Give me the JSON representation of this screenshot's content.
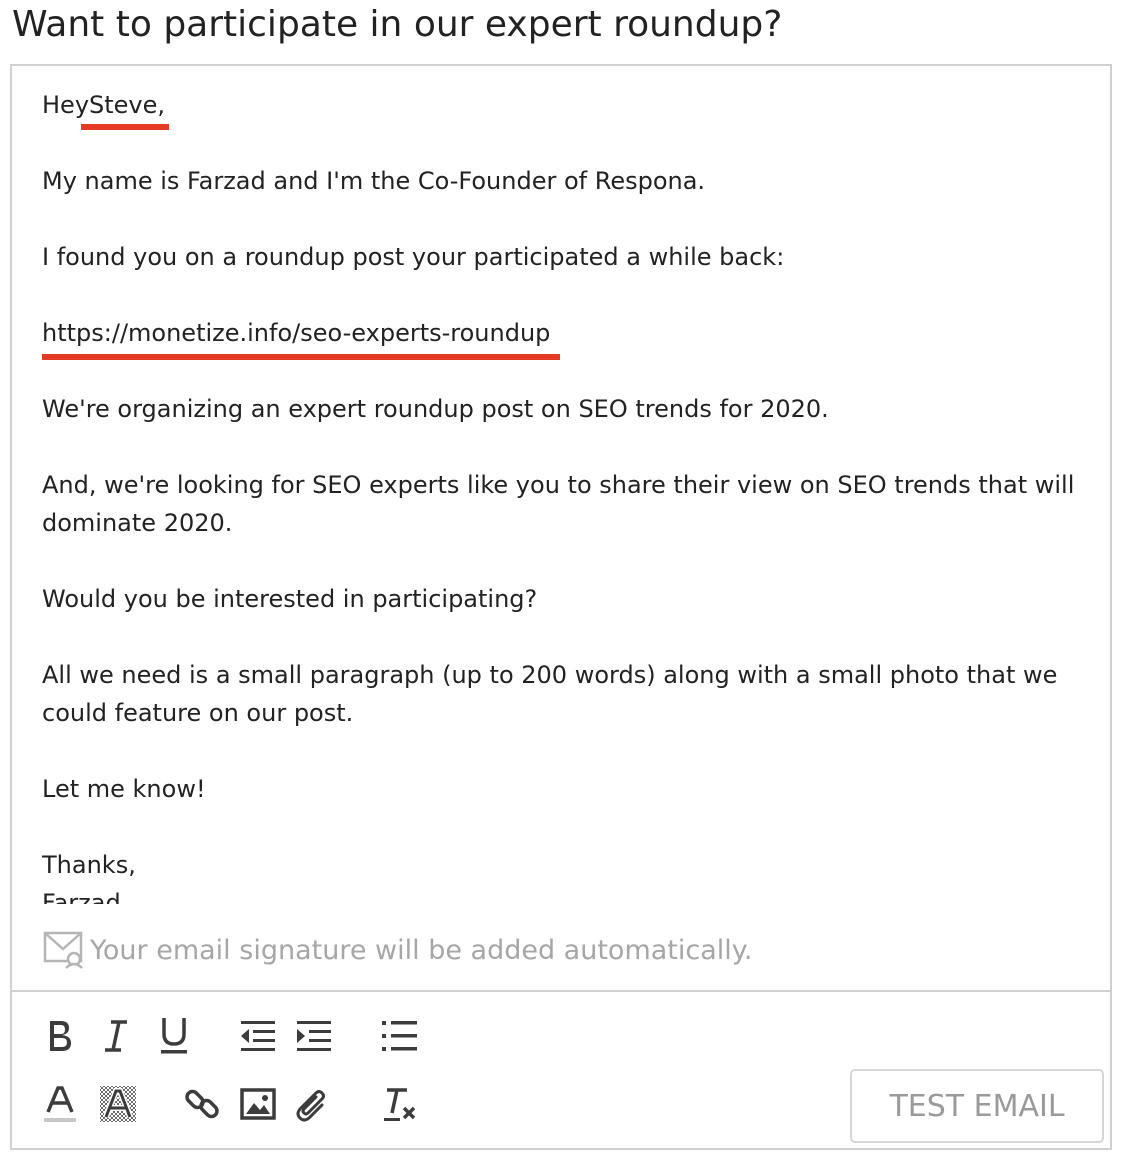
{
  "email": {
    "subject": "Want to participate in our expert roundup?",
    "greeting_prefix": "Hey",
    "greeting_name": " Steve,",
    "paragraphs": [
      "My name is Farzad and I'm the Co-Founder of Respona.",
      "I found you on a roundup post your participated a while back:",
      "https://monetize.info/seo-experts-roundup",
      "We're organizing an expert roundup post on SEO trends for 2020.",
      "And, we're looking for SEO experts like you to share their view on SEO trends that will dominate 2020.",
      "Would you be interested in participating?",
      "All we need is a small paragraph (up to 200 words) along with a small photo that we could feature on our post.",
      "Let me know!"
    ],
    "signoff": "Thanks,",
    "sender_name": "Farzad"
  },
  "signature_note": "Your email signature will be added automatically.",
  "toolbar": {
    "test_email_label": "TEST EMAIL",
    "icons": [
      "bold-icon",
      "italic-icon",
      "underline-icon",
      "outdent-icon",
      "indent-icon",
      "bulleted-list-icon",
      "text-color-icon",
      "highlight-color-icon",
      "link-icon",
      "image-icon",
      "attachment-icon",
      "clear-formatting-icon"
    ]
  },
  "colors": {
    "highlight_underline": "#e53b24",
    "border": "#d0d0d0",
    "placeholder_text": "#a6a6a6",
    "icon": "#3c3c3c"
  }
}
